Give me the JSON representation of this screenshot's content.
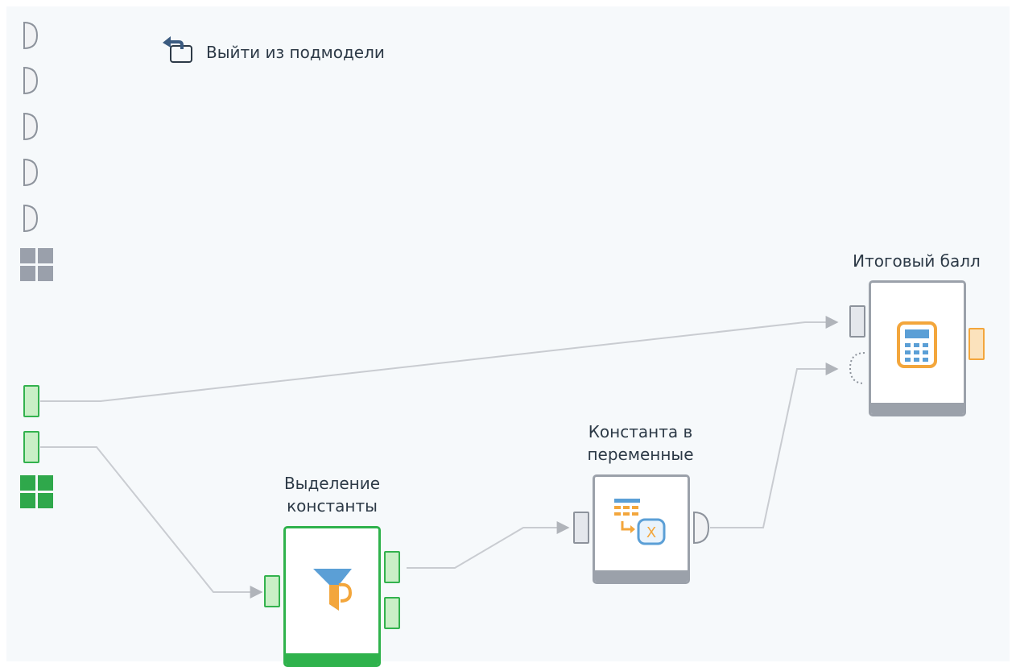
{
  "toolbar": {
    "exit_label": "Выйти из подмодели",
    "exit_icon": "exit-submodel-icon"
  },
  "nodes": {
    "filter": {
      "title_line1": "Выделение",
      "title_line2": "константы",
      "icon": "funnel-icon",
      "status": "active"
    },
    "constant_to_vars": {
      "title_line1": "Константа в",
      "title_line2": "переменные",
      "icon": "table-to-variable-icon"
    },
    "calculator": {
      "title": "Итоговый балл",
      "icon": "calculator-icon"
    }
  },
  "colors": {
    "canvas": "#f6f9fb",
    "gray_port": "#8d939c",
    "green_port": "#33b24e",
    "orange_port": "#f3a63c",
    "wire": "#c5c8cd",
    "active_node": "#2fb24c"
  }
}
